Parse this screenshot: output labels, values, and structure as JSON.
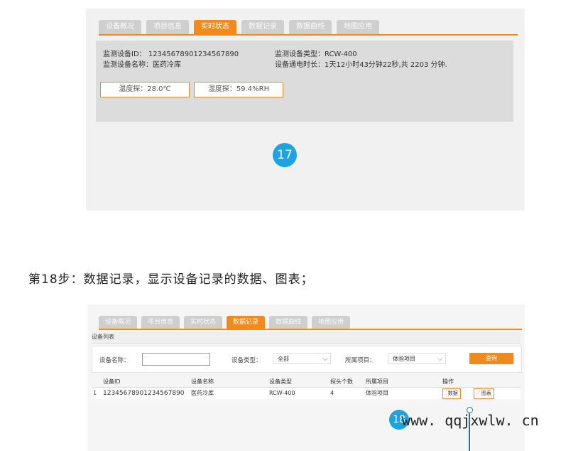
{
  "tabs": [
    "设备概况",
    "项目信息",
    "实时状态",
    "数据记录",
    "数据曲线",
    "地图应用"
  ],
  "panel1": {
    "active_tab": "实时状态",
    "device_id": "监测设备ID： 12345678901234567890",
    "device_name": "监测设备名称：医药冷库",
    "device_type": "监测设备类型：RCW-400",
    "power_on_time": "设备通电时长：1天12小时43分钟22秒,共 2203 分钟.",
    "temp_probe": "温度探：28.0℃",
    "humidity_probe": "湿度探：59.4%RH",
    "badge": "17"
  },
  "step_heading": "第18步：数据记录，显示设备记录的数据、图表；",
  "panel2": {
    "active_tab": "数据记录",
    "list_title": "设备列表",
    "search": {
      "name_label": "设备名称：",
      "name_value": "",
      "type_label": "设备类型：",
      "type_value": "全部",
      "project_label": "所属项目：",
      "project_value": "体验项目",
      "query_button": "查询"
    },
    "columns": [
      "设备ID",
      "设备名称",
      "设备类型",
      "探头个数",
      "所属项目",
      "操作"
    ],
    "rows": [
      {
        "index": "1",
        "device_id": "12345678901234567890",
        "device_name": "医药冷库",
        "device_type": "RCW-400",
        "probe_count": "4",
        "project": "体验项目",
        "action_data": "数据",
        "action_chart": "图表"
      }
    ],
    "badge": "18"
  },
  "watermark": "www. qqjxwlw. cn",
  "colors": {
    "accent": "#f08a1c",
    "badge": "#1fa2e0"
  }
}
